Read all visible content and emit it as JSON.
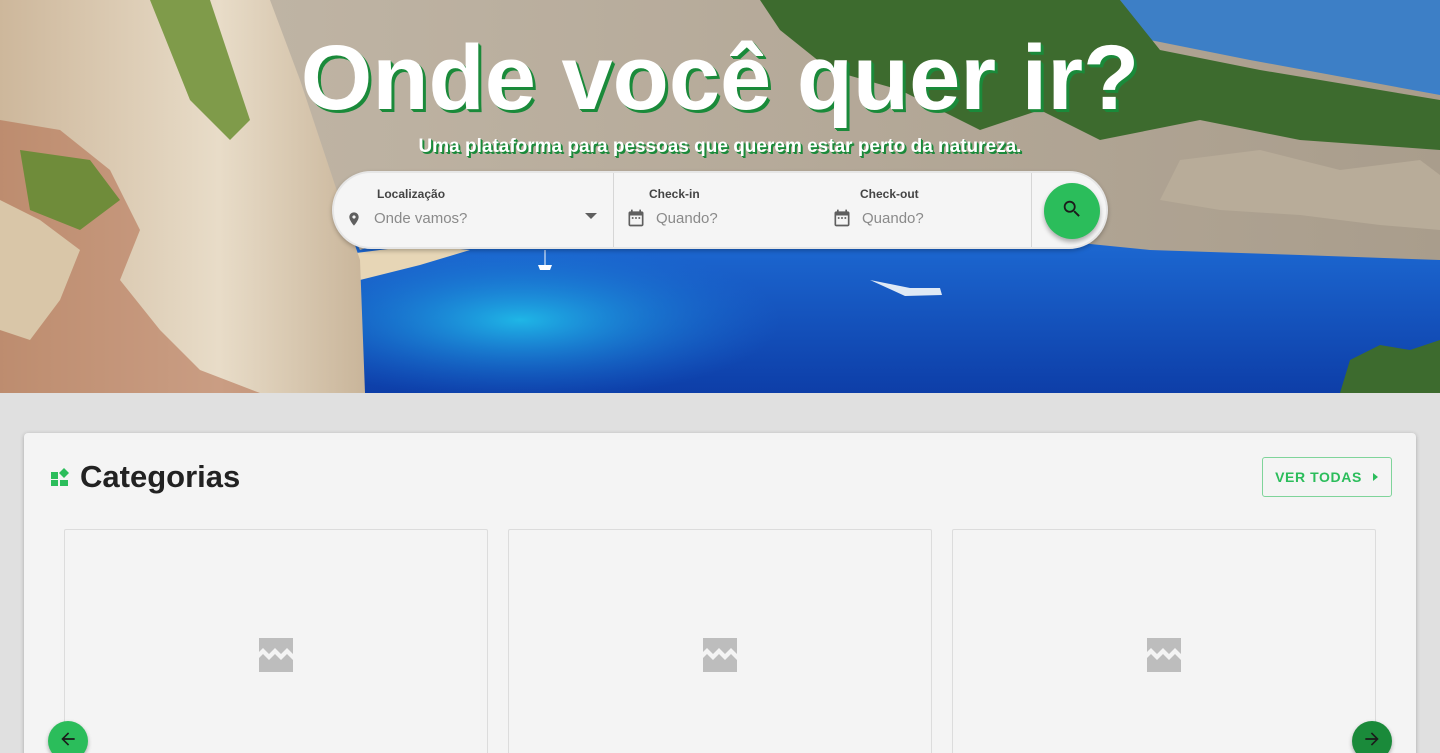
{
  "hero": {
    "title": "Onde você quer ir?",
    "subtitle": "Uma plataforma para pessoas que querem estar perto da natureza."
  },
  "search": {
    "location": {
      "label": "Localização",
      "placeholder": "Onde vamos?",
      "icon": "location-pin-icon"
    },
    "checkin": {
      "label": "Check-in",
      "placeholder": "Quando?",
      "icon": "calendar-icon"
    },
    "checkout": {
      "label": "Check-out",
      "placeholder": "Quando?",
      "icon": "calendar-icon"
    },
    "button_icon": "search-icon"
  },
  "categories": {
    "icon": "widgets-icon",
    "title": "Categorias",
    "view_all_label": "VER TODAS",
    "tiles": [
      {
        "image": "broken-image-icon"
      },
      {
        "image": "broken-image-icon"
      },
      {
        "image": "broken-image-icon"
      }
    ],
    "prev_icon": "arrow-left-icon",
    "next_icon": "arrow-right-icon"
  },
  "colors": {
    "accent": "#2bbd5b",
    "accent_dark": "#1a8a3a",
    "surface": "#f4f4f4",
    "page_bg": "#e0e0e0"
  }
}
